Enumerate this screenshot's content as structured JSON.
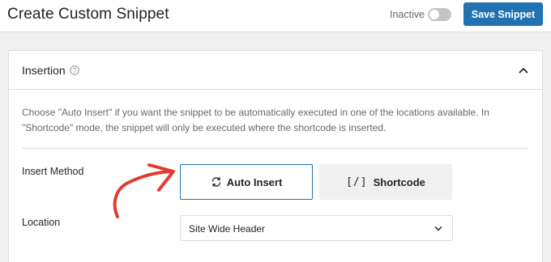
{
  "header": {
    "title": "Create Custom Snippet",
    "status_label": "Inactive",
    "active": false,
    "save_label": "Save Snippet"
  },
  "insertion": {
    "title": "Insertion",
    "description": "Choose \"Auto Insert\" if you want the snippet to be automatically executed in one of the locations available. In \"Shortcode\" mode, the snippet will only be executed where the shortcode is inserted.",
    "insert_method_label": "Insert Method",
    "methods": [
      {
        "label": "Auto Insert",
        "icon": "refresh-icon",
        "selected": true
      },
      {
        "label": "Shortcode",
        "icon": "code-icon",
        "glyph": "[/]",
        "selected": false
      }
    ],
    "location_label": "Location",
    "location_value": "Site Wide Header"
  },
  "colors": {
    "primary": "#2271b1",
    "annotation_arrow": "#e23c2d"
  }
}
